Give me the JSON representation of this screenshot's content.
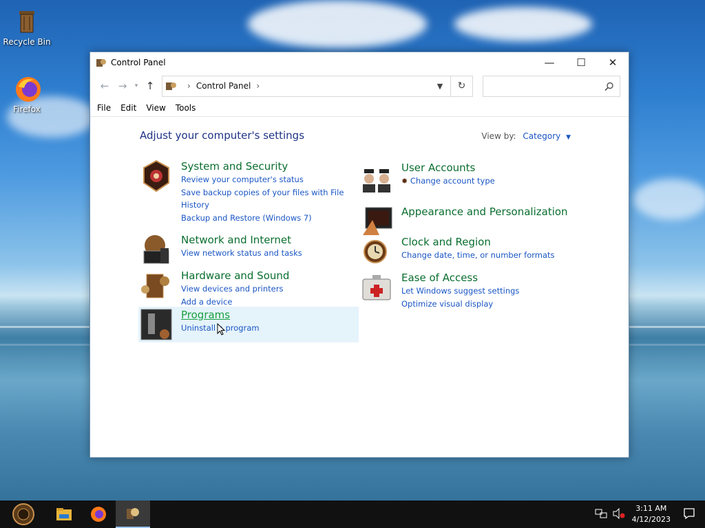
{
  "desktop": {
    "icons": [
      {
        "label": "Recycle Bin"
      },
      {
        "label": "Firefox"
      }
    ]
  },
  "window": {
    "title": "Control Panel",
    "controls": {
      "minimize": "—",
      "maximize": "☐",
      "close": "✕"
    }
  },
  "address": {
    "crumb": "Control Panel",
    "separator": "›",
    "search_placeholder": ""
  },
  "menu": [
    "File",
    "Edit",
    "View",
    "Tools"
  ],
  "content": {
    "heading": "Adjust your computer's settings",
    "view_by_label": "View by:",
    "view_by_value": "Category",
    "left": [
      {
        "title": "System and Security",
        "links": [
          "Review your computer's status",
          "Save backup copies of your files with File",
          "History",
          "Backup and Restore (Windows 7)"
        ]
      },
      {
        "title": "Network and Internet",
        "links": [
          "View network status and tasks"
        ]
      },
      {
        "title": "Hardware and Sound",
        "links": [
          "View devices and printers",
          "Add a device"
        ]
      },
      {
        "title": "Programs",
        "links": [
          "Uninstall a program"
        ]
      }
    ],
    "right": [
      {
        "title": "User Accounts",
        "links": [
          "Change account type"
        ]
      },
      {
        "title": "Appearance and Personalization",
        "links": []
      },
      {
        "title": "Clock and Region",
        "links": [
          "Change date, time, or number formats"
        ]
      },
      {
        "title": "Ease of Access",
        "links": [
          "Let Windows suggest settings",
          "Optimize visual display"
        ]
      }
    ]
  },
  "taskbar": {
    "time": "3:11 AM",
    "date": "4/12/2023"
  },
  "colors": {
    "category_title": "#0a6e2f",
    "link": "#1a56c4",
    "heading": "#1e3287",
    "hover_bg": "#e5f3fb"
  }
}
